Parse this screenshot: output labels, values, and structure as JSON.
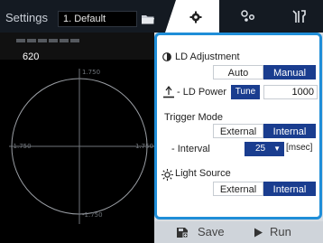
{
  "header": {
    "settings_label": "Settings",
    "preset_value": "1. Default",
    "folder_icon": "folder-icon"
  },
  "monitor": {
    "value": "620",
    "axis_tick": "1.750",
    "axis_tick_neg": "-1.750"
  },
  "tabs": [
    {
      "icon": "gear-icon",
      "active": true
    },
    {
      "icon": "hierarchy-icon",
      "active": false
    },
    {
      "icon": "tools-icon",
      "active": false
    }
  ],
  "panel": {
    "ld_adjustment": {
      "label": "LD Adjustment",
      "options": [
        "Auto",
        "Manual"
      ],
      "selected": "Manual"
    },
    "ld_power": {
      "label": "- LD Power",
      "tune_label": "Tune",
      "value": "1000"
    },
    "trigger_mode": {
      "label": "Trigger Mode",
      "options": [
        "External",
        "Internal"
      ],
      "selected": "Internal"
    },
    "interval": {
      "label": "- Interval",
      "value": "25",
      "unit": "[msec]"
    },
    "light_source": {
      "label": "Light Source",
      "options": [
        "External",
        "Internal"
      ],
      "selected": "Internal"
    }
  },
  "footer": {
    "save_label": "Save",
    "run_label": "Run"
  },
  "colors": {
    "accent": "#1f8ed8",
    "selected": "#1a3d8f",
    "dark_bg": "#141a22"
  }
}
